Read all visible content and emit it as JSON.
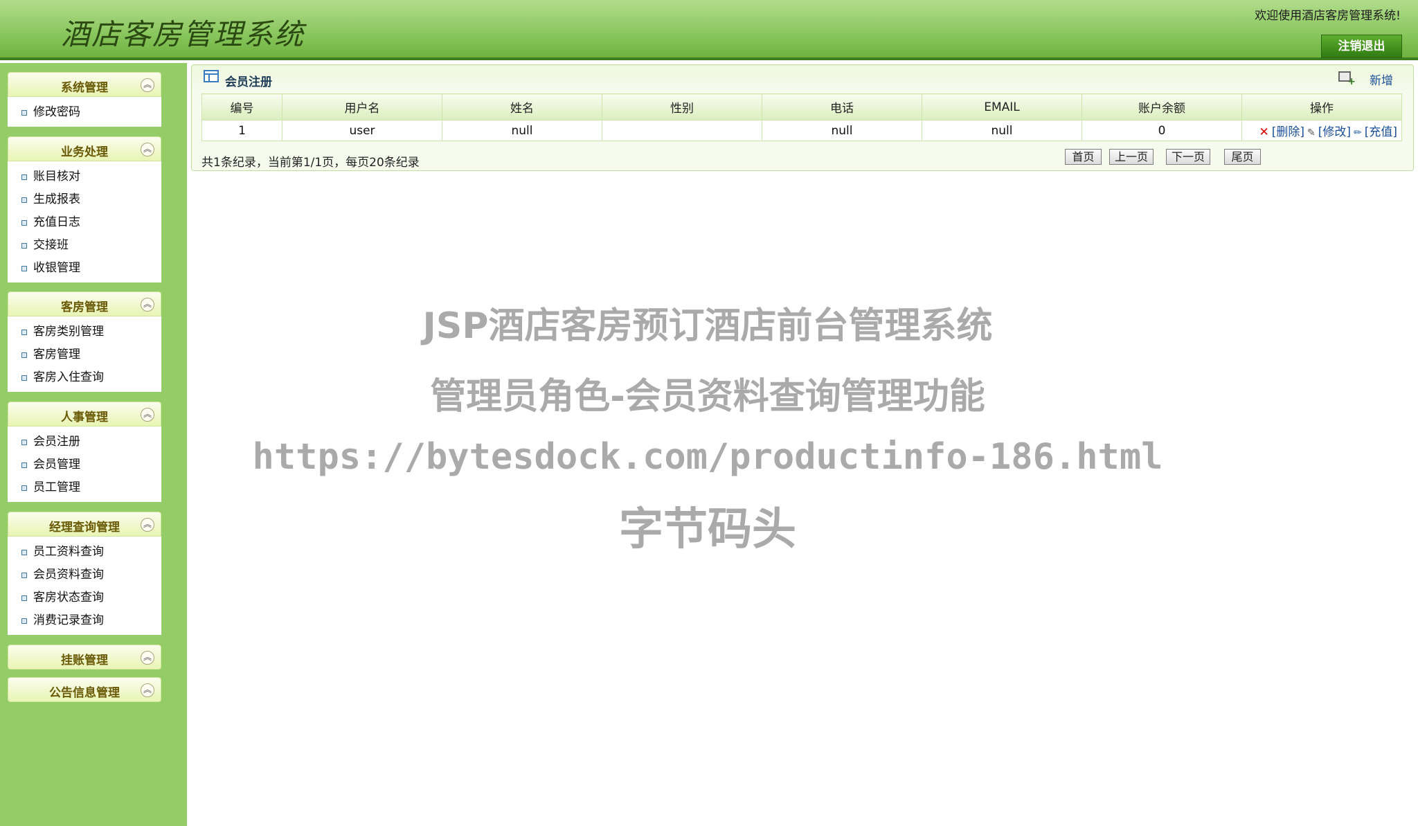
{
  "header": {
    "title": "酒店客房管理系统",
    "welcome": "欢迎使用酒店客房管理系统!",
    "logout_label": "注销退出"
  },
  "sidebar": {
    "groups": [
      {
        "title": "系统管理",
        "items": [
          "修改密码"
        ]
      },
      {
        "title": "业务处理",
        "items": [
          "账目核对",
          "生成报表",
          "充值日志",
          "交接班",
          "收银管理"
        ]
      },
      {
        "title": "客房管理",
        "items": [
          "客房类别管理",
          "客房管理",
          "客房入住查询"
        ]
      },
      {
        "title": "人事管理",
        "items": [
          "会员注册",
          "会员管理",
          "员工管理"
        ]
      },
      {
        "title": "经理查询管理",
        "items": [
          "员工资料查询",
          "会员资料查询",
          "客房状态查询",
          "消费记录查询"
        ]
      },
      {
        "title": "挂账管理",
        "items": []
      },
      {
        "title": "公告信息管理",
        "items": []
      }
    ]
  },
  "panel": {
    "title": "会员注册",
    "add_label": "新增",
    "columns": [
      "编号",
      "用户名",
      "姓名",
      "性别",
      "电话",
      "EMAIL",
      "账户余额",
      "操作"
    ],
    "rows": [
      {
        "id": "1",
        "username": "user",
        "name": "null",
        "gender": "",
        "phone": "null",
        "email": "null",
        "balance": "0",
        "ops": {
          "delete": "[删除]",
          "edit": "[修改]",
          "recharge": "[充值]"
        }
      }
    ],
    "pager": {
      "info": "共1条纪录，当前第1/1页，每页20条纪录",
      "first": "首页",
      "prev": "上一页",
      "next": "下一页",
      "last": "尾页"
    }
  },
  "watermark": {
    "title": "JSP酒店客房预订酒店前台管理系统",
    "subtitle": "管理员角色-会员资料查询管理功能",
    "url": "https://bytesdock.com/productinfo-186.html",
    "brand": "字节码头"
  }
}
